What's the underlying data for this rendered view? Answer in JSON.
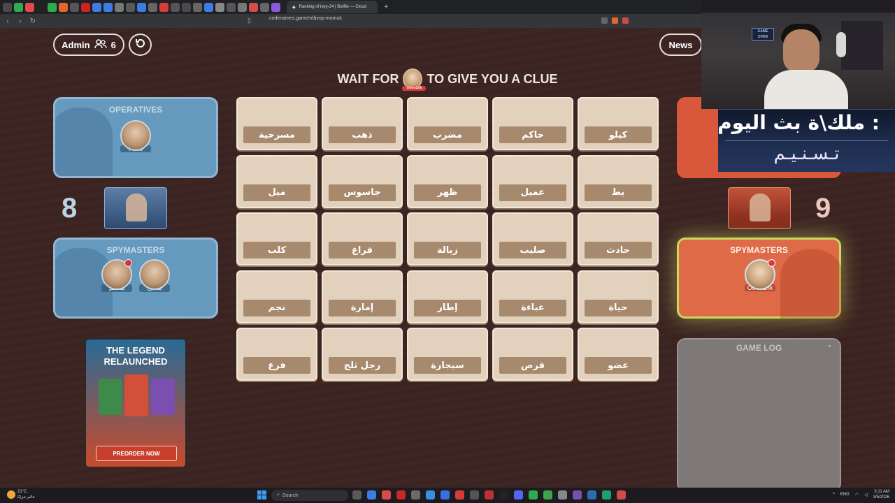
{
  "browser": {
    "active_tab_title": "Ranking of ivey-24 | Botfile — Cloud",
    "new_tab_symbol": "+",
    "url": "codenames.game/r/divop-momuk",
    "tab_icon_colors": [
      "#4a4a4a",
      "#2eaa4f",
      "#e44a4a",
      "#222222",
      "#2eaa4f",
      "#e3662b",
      "#555555",
      "#cc2222",
      "#3e7be3",
      "#3e7be3",
      "#777777",
      "#5a5a5a",
      "#3e7be3",
      "#666666",
      "#d93b3b",
      "#555555",
      "#4a4a4a",
      "#666666",
      "#3e7be3",
      "#888888",
      "#555555",
      "#777777",
      "#d94a4a",
      "#666666",
      "#8a5ad8"
    ]
  },
  "header": {
    "admin_label": "Admin",
    "players_icon": "users-icon",
    "player_count": "6",
    "refresh_icon": "refresh-icon",
    "news_label": "News"
  },
  "clue_banner": {
    "before": "WAIT FOR",
    "avatar_name": "Othm2nk",
    "after": "TO GIVE YOU A CLUE"
  },
  "blue_team": {
    "score": "8",
    "operatives_title": "OPERATIVES",
    "operatives": [
      {
        "name": "Faris"
      }
    ],
    "spymasters_title": "SPYMASTERS",
    "spymasters": [
      {
        "name": "معظم"
      },
      {
        "name": "سجى"
      }
    ],
    "color": "#6aa3cc"
  },
  "red_team": {
    "score": "9",
    "spymasters_title": "SPYMASTERS",
    "spymasters": [
      {
        "name": "Othm2nk"
      }
    ],
    "color": "#df6a47"
  },
  "promo": {
    "title_line1": "THE LEGEND",
    "title_line2": "RELAUNCHED",
    "button_label": "PREORDER NOW"
  },
  "board": {
    "cards": [
      "مسرحية",
      "ذهب",
      "مضرب",
      "حاكم",
      "كيلو",
      "ميل",
      "جاسوس",
      "ظهر",
      "عميل",
      "بط",
      "كلب",
      "فراغ",
      "زبالة",
      "صليب",
      "حادث",
      "نجم",
      "إمارة",
      "إطار",
      "عباءة",
      "حياة",
      "فرع",
      "رجل ثلج",
      "سيجارة",
      "قرص",
      "عضو"
    ]
  },
  "game_log": {
    "title": "GAME LOG"
  },
  "stream_overlay": {
    "line1": "ملك\\ة بث اليوم :",
    "line2": "تـسـنـيـم",
    "sign_label": "GAME OVER"
  },
  "taskbar": {
    "weather_temp": "21°C",
    "weather_desc": "غائم جزئيًا",
    "search_placeholder": "Search",
    "language": "ENG",
    "time": "3:11 AM",
    "date": "3/5/2026"
  }
}
